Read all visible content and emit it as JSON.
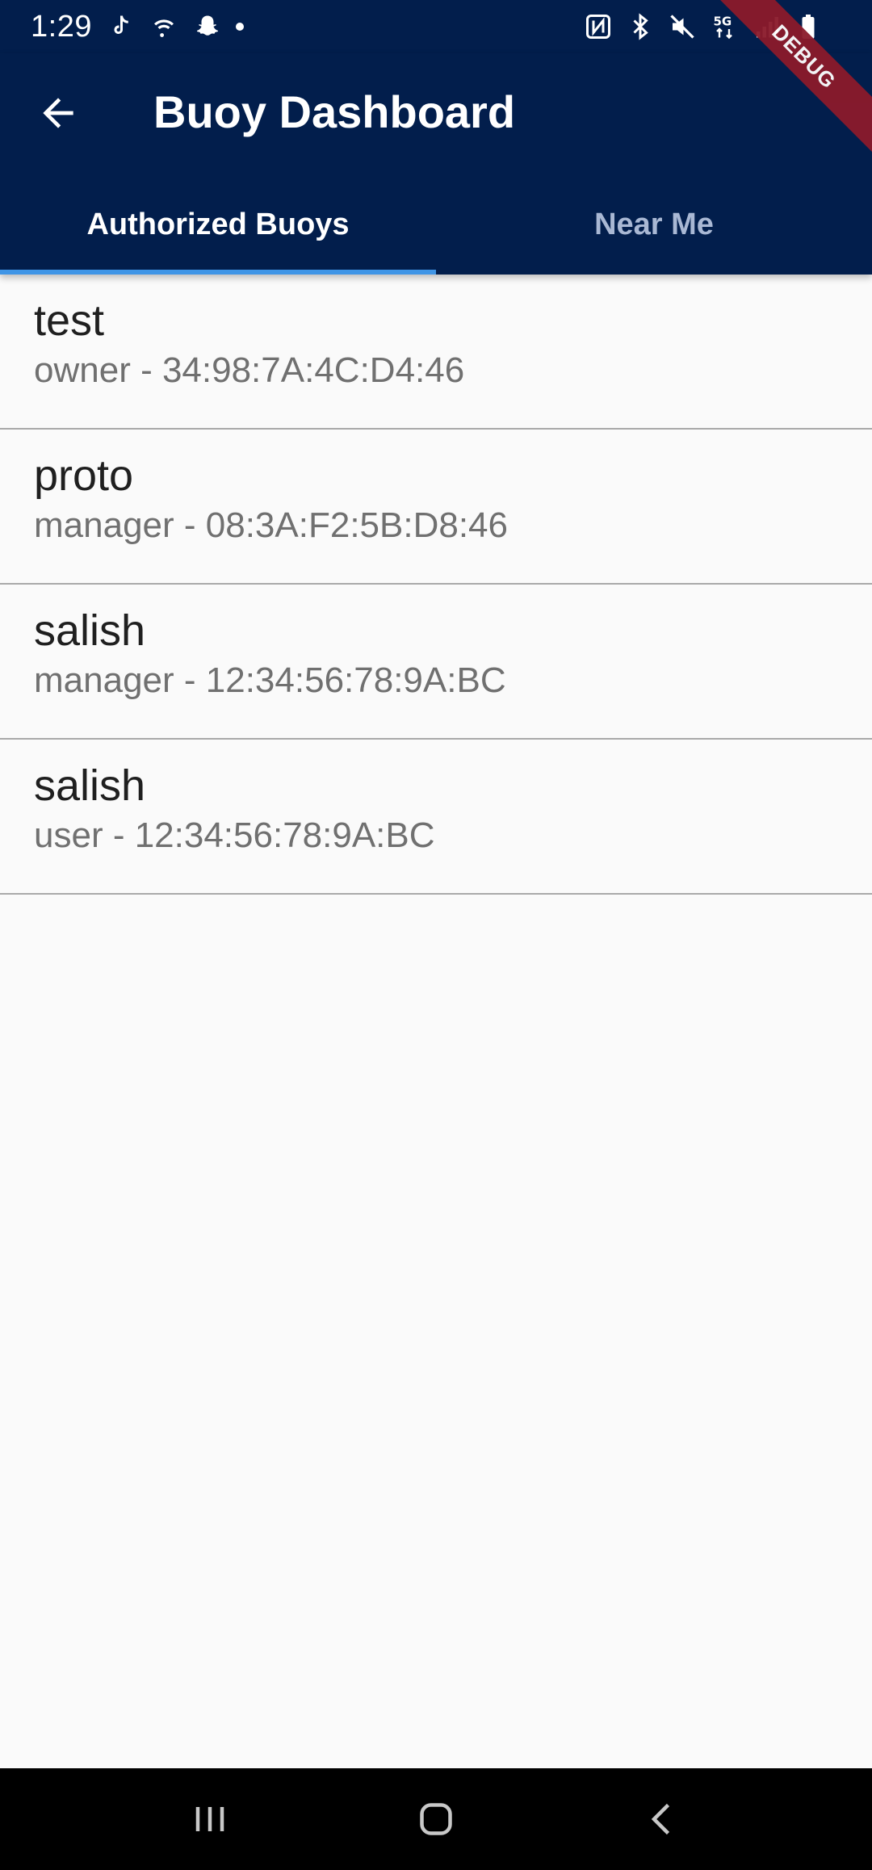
{
  "status_bar": {
    "time": "1:29",
    "left_icons": [
      "tiktok-icon",
      "wifi-icon",
      "snapchat-icon",
      "dot-icon"
    ],
    "right_icons": [
      "nfc-icon",
      "bluetooth-icon",
      "mute-icon",
      "5g-icon",
      "signal-icon",
      "battery-icon"
    ],
    "network_label": "5G"
  },
  "debug_banner": {
    "label": "DEBUG"
  },
  "app_bar": {
    "title": "Buoy Dashboard",
    "back_icon": "arrow-back-icon"
  },
  "tabs": [
    {
      "label": "Authorized Buoys",
      "active": true
    },
    {
      "label": "Near Me",
      "active": false
    }
  ],
  "buoys": [
    {
      "name": "test",
      "detail": "owner - 34:98:7A:4C:D4:46"
    },
    {
      "name": "proto",
      "detail": "manager - 08:3A:F2:5B:D8:46"
    },
    {
      "name": "salish",
      "detail": "manager - 12:34:56:78:9A:BC"
    },
    {
      "name": "salish",
      "detail": "user - 12:34:56:78:9A:BC"
    }
  ],
  "nav_bar": {
    "buttons": [
      "recents-icon",
      "home-icon",
      "back-icon"
    ]
  },
  "colors": {
    "app_bar_bg": "#021e4c",
    "tab_indicator": "#3f95e6",
    "page_bg": "#fafafa",
    "debug_ribbon": "#8b1a2b"
  }
}
